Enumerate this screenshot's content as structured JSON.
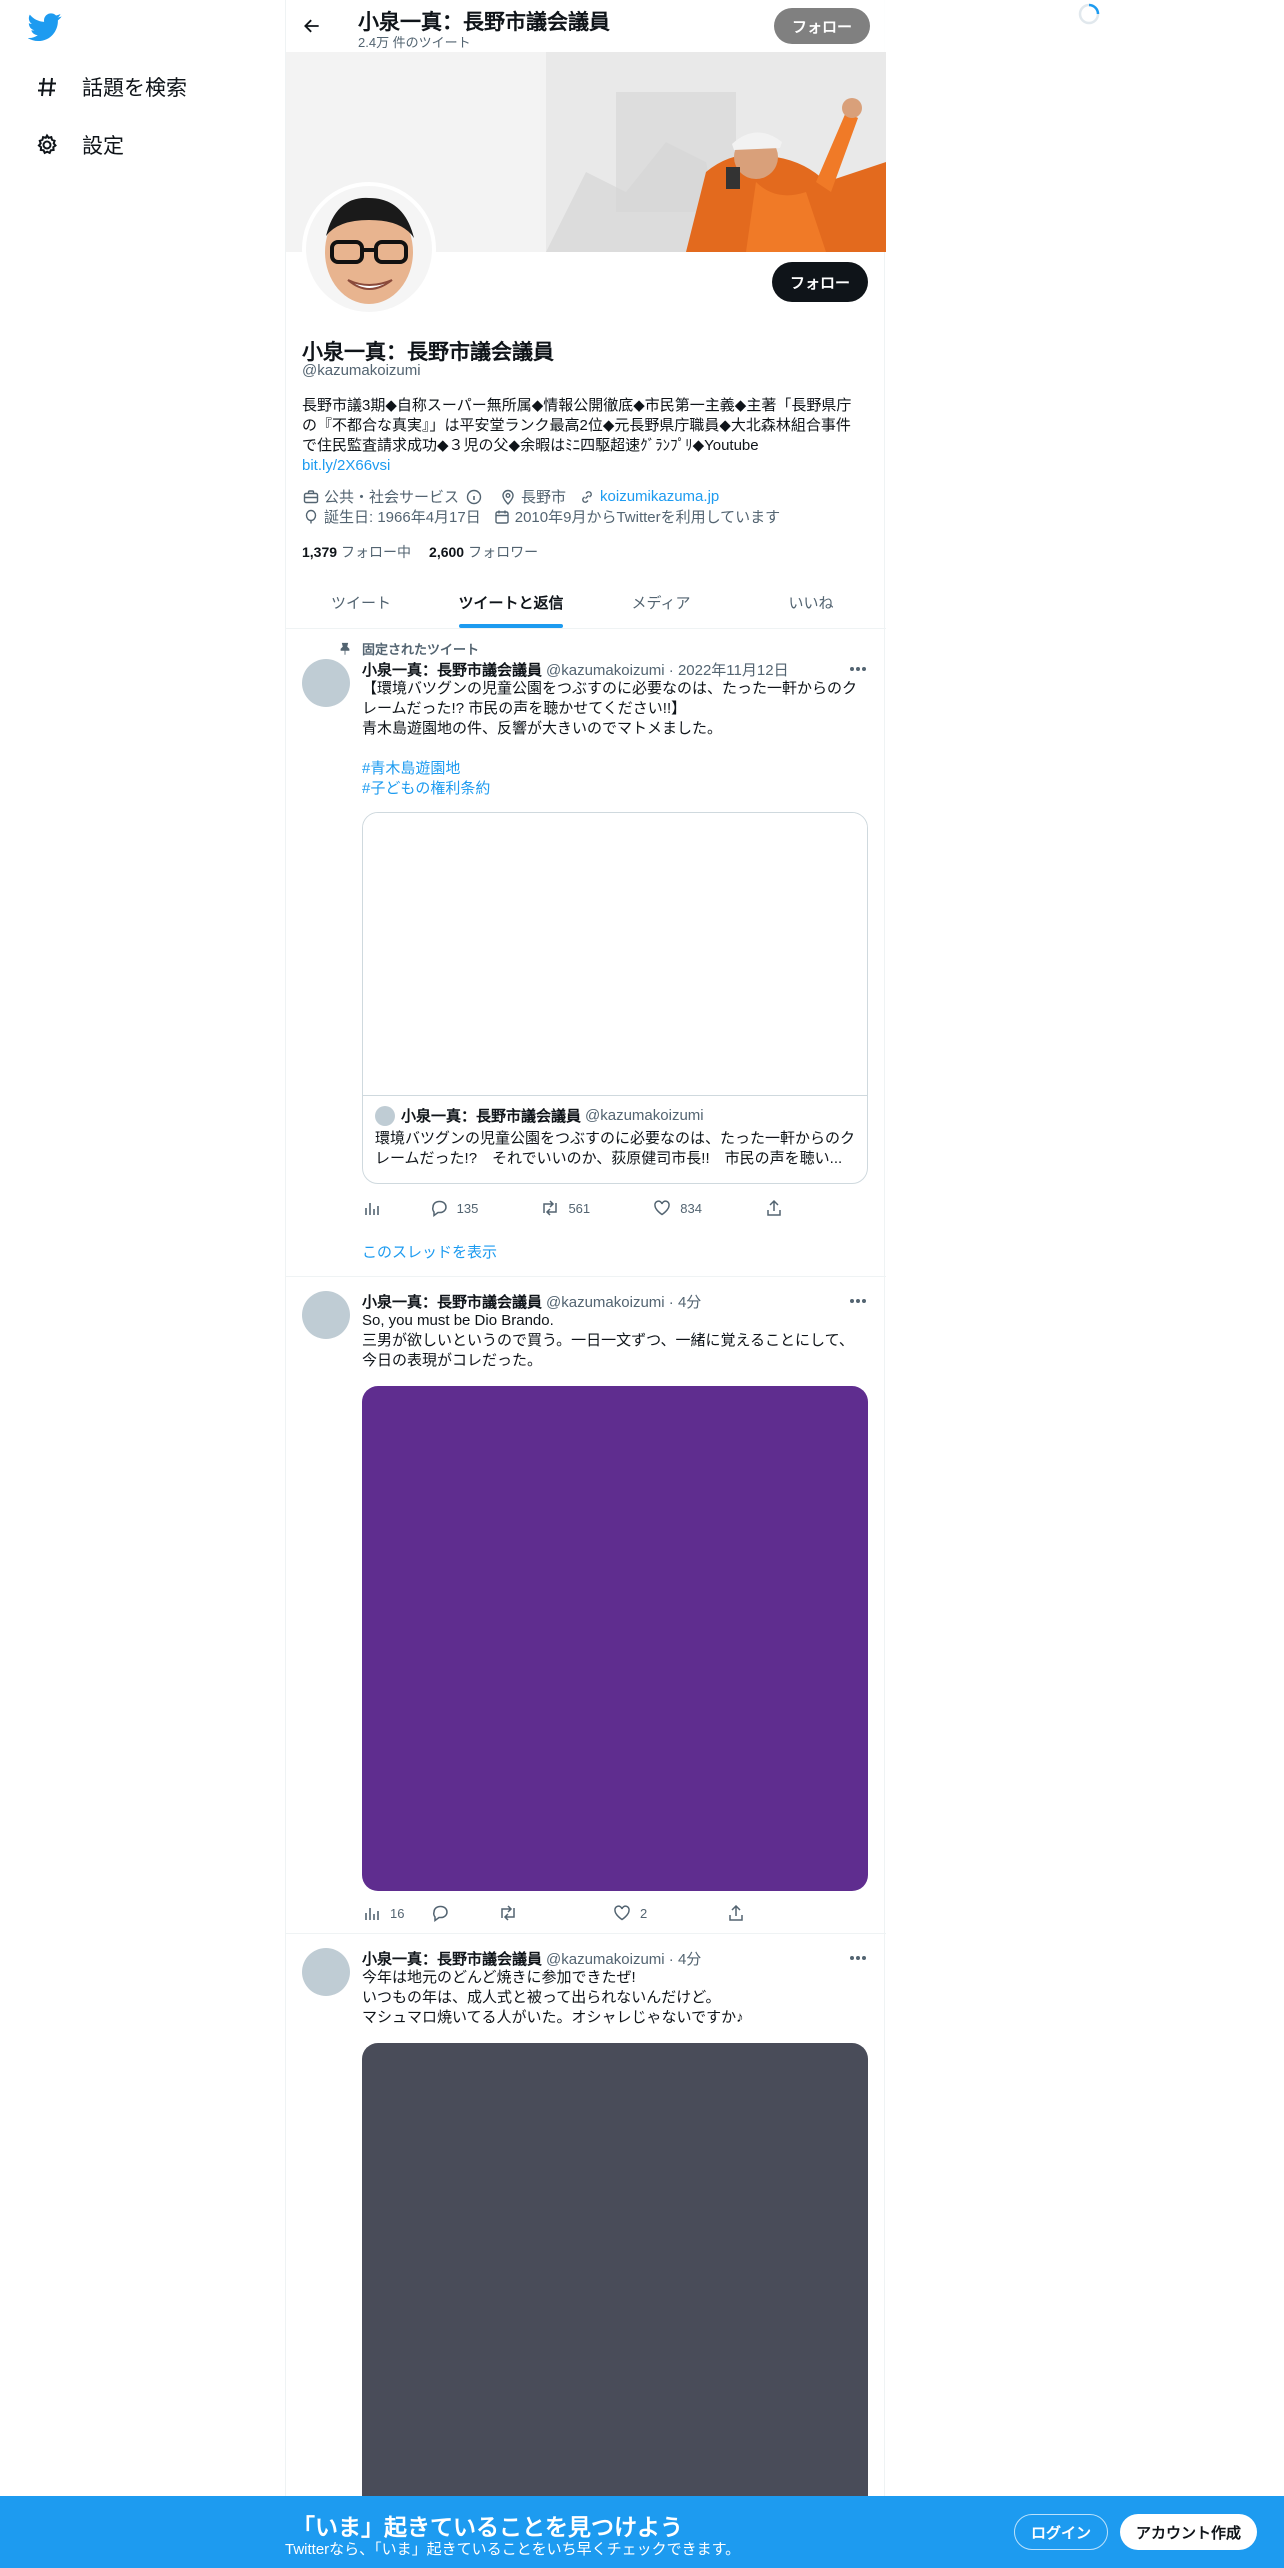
{
  "sidebar": {
    "logo": "twitter-bird-icon",
    "items": [
      {
        "label": "話題を検索",
        "icon": "hashtag-icon"
      },
      {
        "label": "設定",
        "icon": "gear-icon"
      }
    ]
  },
  "header": {
    "name": "小泉一真：長野市議会議員",
    "tweet_count": "2.4万 件のツイート",
    "follow_label": "フォロー"
  },
  "profile": {
    "name": "小泉一真：長野市議会議員",
    "handle": "@kazumakoizumi",
    "follow_label": "フォロー",
    "bio_line1": "長野市議3期◆自称スーパー無所属◆情報公開徹底◆市民第一主義◆主著「長野県庁",
    "bio_line2": "の『不都合な真実』」は平安堂ランク最高2位◆元長野県庁職員◆大北森林組合事件",
    "bio_line3": "で住民監査請求成功◆３児の父◆余暇はﾐﾆ四駆超速ｸﾞﾗﾝﾌﾟﾘ◆Youtube",
    "bio_link": "bit.ly/2X66vsi",
    "category": "公共・社会サービス",
    "location": "長野市",
    "website": "koizumikazuma.jp",
    "birthday": "誕生日: 1966年4月17日",
    "joined": "2010年9月からTwitterを利用しています",
    "following_count": "1,379",
    "following_label": "フォロー中",
    "followers_count": "2,600",
    "followers_label": "フォロワー"
  },
  "tabs": [
    {
      "label": "ツイート",
      "active": false
    },
    {
      "label": "ツイートと返信",
      "active": true
    },
    {
      "label": "メディア",
      "active": false
    },
    {
      "label": "いいね",
      "active": false
    }
  ],
  "tweets": [
    {
      "pinned_label": "固定されたツイート",
      "name": "小泉一真：長野市議会議員",
      "meta": "@kazumakoizumi · 2022年11月12日",
      "text1": "【環境バツグンの児童公園をつぶすのに必要なのは、たった一軒からのク",
      "text2": "レームだった!? 市民の声を聴かせてください!!】",
      "text3": "青木島遊園地の件、反響が大きいのでマトメました。",
      "hashtag1": "#青木島遊園地",
      "hashtag2": "#子どもの権利条約",
      "quote": {
        "name": "小泉一真：長野市議会議員",
        "handle": "@kazumakoizumi",
        "text1": "環境バツグンの児童公園をつぶすのに必要なのは、たった一軒からのク",
        "text2": "レームだった!?　それでいいのか、荻原健司市長!!　市民の声を聴い..."
      },
      "replies": "135",
      "retweets": "561",
      "likes": "834",
      "show_thread": "このスレッドを表示"
    },
    {
      "name": "小泉一真：長野市議会議員",
      "meta": "@kazumakoizumi · 4分",
      "text1": "So, you must be Dio Brando.",
      "text2": "三男が欲しいというので買う。一日一文ずつ、一緒に覚えることにして、",
      "text3": "今日の表現がコレだった。",
      "media_color": "#5f2d8f",
      "views": "16",
      "likes": "2"
    },
    {
      "name": "小泉一真：長野市議会議員",
      "meta": "@kazumakoizumi · 4分",
      "text1": "今年は地元のどんど焼きに参加できたぜ!",
      "text2": "いつもの年は、成人式と被って出られないんだけど。",
      "text3": "マシュマロ焼いてる人がいた。オシャレじゃないですか♪",
      "media_color": "#494c59"
    }
  ],
  "bottom_bar": {
    "title": "「いま」起きていることを見つけよう",
    "subtitle": "Twitterなら、「いま」起きていることをいち早くチェックできます。",
    "login_label": "ログイン",
    "signup_label": "アカウント作成"
  },
  "colors": {
    "accent": "#1d9bf0",
    "text": "#0f1419",
    "secondary": "#536471"
  }
}
